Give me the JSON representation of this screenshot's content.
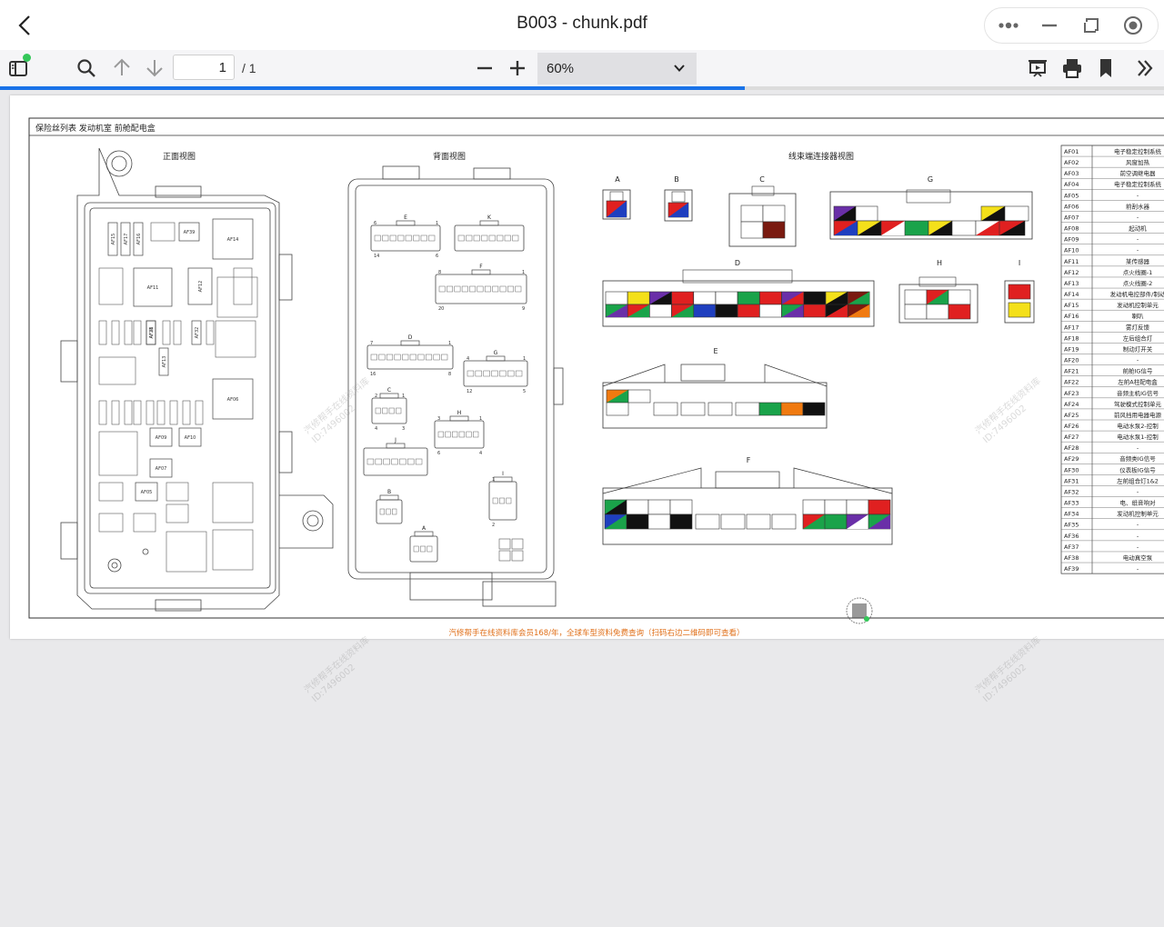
{
  "window": {
    "title": "B003 - chunk.pdf"
  },
  "toolbar": {
    "page_current": "1",
    "page_total": "/ 1",
    "zoom": "60%",
    "load_progress": 0.64
  },
  "document": {
    "header_title": "保险丝列表 发动机室 前舱配电盒",
    "front_view": "正面视图",
    "back_view": "背面视图",
    "connector_view": "线束端连接器视图",
    "footer_promo": "汽修帮手在线资料库会员168/年，全球车型资料免费查询（扫码右边二维码即可查看）",
    "watermark": "汽修帮手在线资料库",
    "watermark_id": "ID:7496002",
    "fuse_labels": [
      "AF39",
      "AF14",
      "AF11",
      "AF12",
      "AF06",
      "AF09",
      "AF10",
      "AF07",
      "AF05",
      "AF15",
      "AF17",
      "AF16",
      "AF28",
      "AF32",
      "AF13",
      "AF31"
    ],
    "back_connectors": [
      {
        "id": "E",
        "left": "6",
        "right": "1",
        "bl": "14",
        "br": "6"
      },
      {
        "id": "K",
        "left": "",
        "right": "",
        "bl": "",
        "br": ""
      },
      {
        "id": "F",
        "left": "8",
        "right": "1",
        "bl": "20",
        "br": "9"
      },
      {
        "id": "D",
        "left": "7",
        "right": "1",
        "bl": "16",
        "br": "8"
      },
      {
        "id": "G",
        "left": "4",
        "right": "1",
        "bl": "12",
        "br": "5"
      },
      {
        "id": "C",
        "left": "2",
        "right": "1",
        "bl": "4",
        "br": "3"
      },
      {
        "id": "H",
        "left": "3",
        "right": "1",
        "bl": "6",
        "br": "4"
      },
      {
        "id": "J",
        "left": "",
        "right": "",
        "bl": "",
        "br": ""
      },
      {
        "id": "I",
        "left": "1",
        "right": "",
        "bl": "2",
        "br": ""
      },
      {
        "id": "B",
        "left": "",
        "right": "",
        "bl": "",
        "br": ""
      },
      {
        "id": "A",
        "left": "",
        "right": "",
        "bl": "",
        "br": ""
      }
    ],
    "connector_letters": [
      "A",
      "B",
      "C",
      "G",
      "D",
      "H",
      "I",
      "E",
      "F"
    ],
    "fuse_table": [
      [
        "AF01",
        "电子稳定控制系统"
      ],
      [
        "AF02",
        "风窗加热"
      ],
      [
        "AF03",
        "前空调继电器"
      ],
      [
        "AF04",
        "电子稳定控制系统"
      ],
      [
        "AF05",
        "-"
      ],
      [
        "AF06",
        "前刮水器"
      ],
      [
        "AF07",
        "-"
      ],
      [
        "AF08",
        "起动机"
      ],
      [
        "AF09",
        "-"
      ],
      [
        "AF10",
        "-"
      ],
      [
        "AF11",
        "某传感器"
      ],
      [
        "AF12",
        "点火线圈-1"
      ],
      [
        "AF13",
        "点火线圈-2"
      ],
      [
        "AF14",
        "发动机电控部件/制动"
      ],
      [
        "AF15",
        "发动机控制单元"
      ],
      [
        "AF16",
        "喇叭"
      ],
      [
        "AF17",
        "雾灯反馈"
      ],
      [
        "AF18",
        "左后组合灯"
      ],
      [
        "AF19",
        "制动灯开关"
      ],
      [
        "AF20",
        "-"
      ],
      [
        "AF21",
        "前舱IG信号"
      ],
      [
        "AF22",
        "左前A柱配电盒"
      ],
      [
        "AF23",
        "音频主机IG信号"
      ],
      [
        "AF24",
        "驾驶模式控制单元"
      ],
      [
        "AF25",
        "前风挡用电器电源"
      ],
      [
        "AF26",
        "电动水泵2-控制"
      ],
      [
        "AF27",
        "电动水泵1-控制"
      ],
      [
        "AF28",
        "-"
      ],
      [
        "AF29",
        "音频类IG信号"
      ],
      [
        "AF30",
        "仪表板IG信号"
      ],
      [
        "AF31",
        "左前组合灯1&2"
      ],
      [
        "AF32",
        "-"
      ],
      [
        "AF33",
        "电、纸音响对"
      ],
      [
        "AF34",
        "发动机控制单元"
      ],
      [
        "AF35",
        "-"
      ],
      [
        "AF36",
        "-"
      ],
      [
        "AF37",
        "-"
      ],
      [
        "AF38",
        "电动真空泵"
      ],
      [
        "AF39",
        "-"
      ]
    ]
  },
  "colors": {
    "accent": "#1a73e8",
    "wire_red": "#e02020",
    "wire_blue": "#1f3fbf",
    "wire_green": "#1aa34a",
    "wire_yellow": "#f4e01a",
    "wire_violet": "#6a2fa8",
    "wire_black": "#111111",
    "wire_orange": "#f07a10",
    "wire_brown": "#7a1a10",
    "promo": "#e0701a"
  }
}
